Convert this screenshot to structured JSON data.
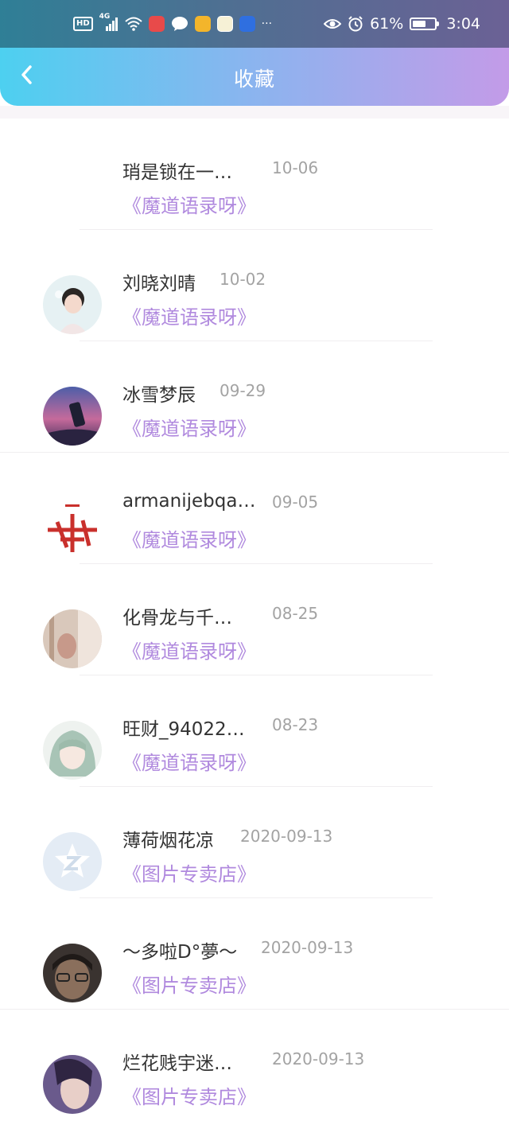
{
  "status_bar": {
    "hd": "HD",
    "network": "4G",
    "more": "···",
    "battery_percent": "61%",
    "battery_level": 0.61,
    "time": "3:04",
    "icons": [
      "hd-icon",
      "signal-icon",
      "wifi-icon",
      "app-red-icon",
      "chat-icon",
      "app-yellow-icon",
      "app-face-icon",
      "app-blue-icon",
      "eye-icon",
      "alarm-icon",
      "battery-icon"
    ]
  },
  "nav": {
    "title": "收藏",
    "back_icon": "chevron-left-icon"
  },
  "colors": {
    "accent": "#b089de",
    "gradient_start": "#4dd0f0",
    "gradient_end": "#c39be8"
  },
  "items": [
    {
      "name": "琑是锁在一…",
      "date": "10-06",
      "source": "《魔道语录呀》",
      "avatar": "none"
    },
    {
      "name": "刘晓刘晴",
      "date": "10-02",
      "source": "《魔道语录呀》",
      "avatar": "girl-photo"
    },
    {
      "name": "冰雪梦辰",
      "date": "09-29",
      "source": "《魔道语录呀》",
      "avatar": "sunset-photo"
    },
    {
      "name": "armanijebqa…",
      "date": "09-05",
      "source": "《魔道语录呀》",
      "avatar": "red-calligraphy"
    },
    {
      "name": "化骨龙与千…",
      "date": "08-25",
      "source": "《魔道语录呀》",
      "avatar": "hand-photo"
    },
    {
      "name": "旺财_94022…",
      "date": "08-23",
      "source": "《魔道语录呀》",
      "avatar": "anime-girl"
    },
    {
      "name": "薄荷烟花凉",
      "date": "2020-09-13",
      "source": "《图片专卖店》",
      "avatar": "qzone-default"
    },
    {
      "name": "～多啦D°夢～",
      "date": "2020-09-13",
      "source": "《图片专卖店》",
      "avatar": "glasses-photo"
    },
    {
      "name": "烂花贱宇迷…",
      "date": "2020-09-13",
      "source": "《图片专卖店》",
      "avatar": "portrait-photo"
    }
  ]
}
